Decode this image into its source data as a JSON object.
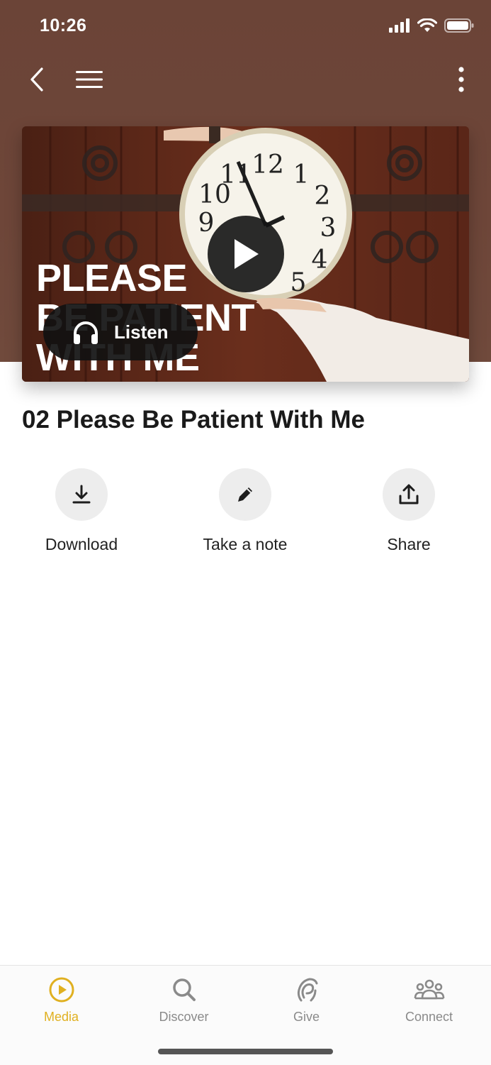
{
  "status_bar": {
    "time": "10:26"
  },
  "nav": {
    "back_icon": "chevron-left-icon",
    "menu_icon": "hamburger-icon",
    "more_icon": "more-vertical-icon"
  },
  "hero": {
    "title_lines": [
      "PLEASE",
      "BE PATIENT",
      "WITH ME"
    ],
    "listen_label": "Listen",
    "play_icon": "play-icon",
    "listen_icon": "headphones-icon"
  },
  "episode": {
    "title": "02 Please Be Patient With Me"
  },
  "actions": [
    {
      "label": "Download",
      "icon": "download-icon"
    },
    {
      "label": "Take a note",
      "icon": "pencil-icon"
    },
    {
      "label": "Share",
      "icon": "share-icon"
    }
  ],
  "tabs": [
    {
      "label": "Media",
      "icon": "play-circle-icon",
      "active": true
    },
    {
      "label": "Discover",
      "icon": "search-icon",
      "active": false
    },
    {
      "label": "Give",
      "icon": "give-icon",
      "active": false
    },
    {
      "label": "Connect",
      "icon": "people-icon",
      "active": false
    }
  ],
  "colors": {
    "header_bg": "#6b4437",
    "accent": "#e0b020",
    "tab_inactive": "#8a8a8a"
  }
}
